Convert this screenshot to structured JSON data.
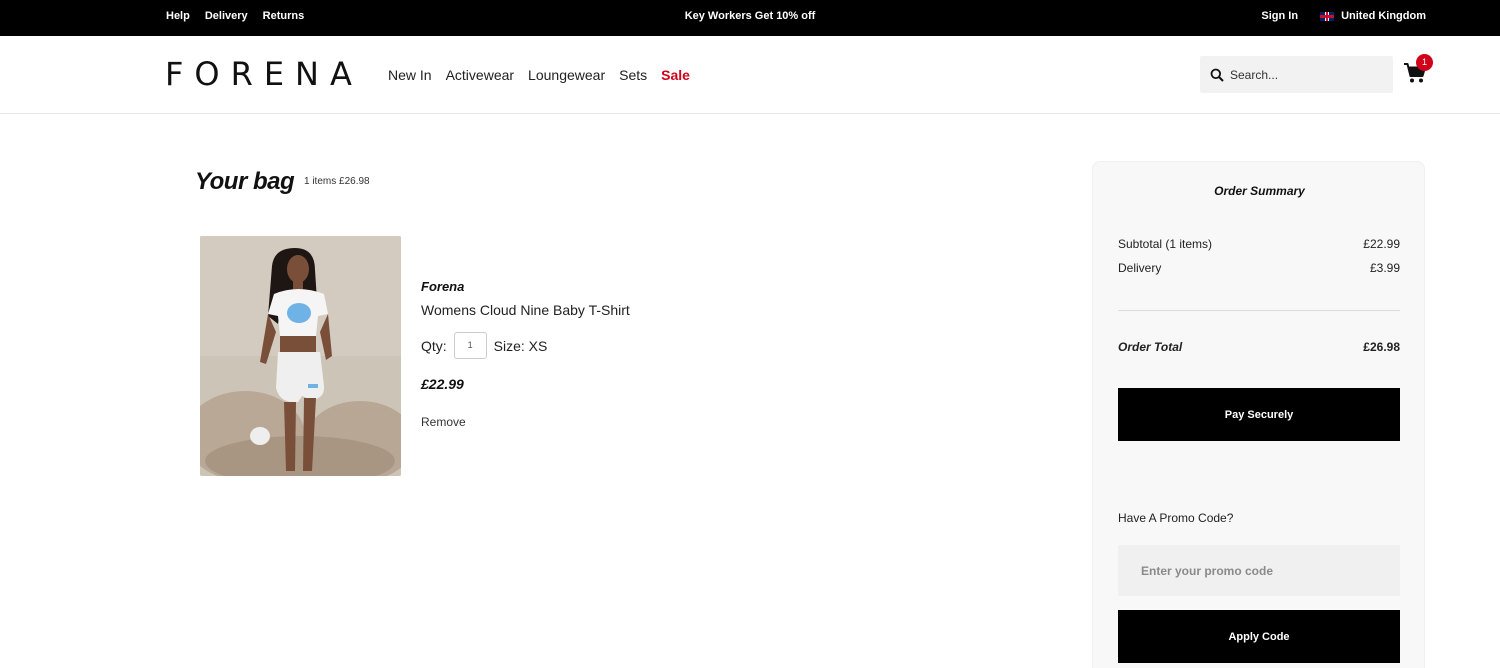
{
  "topbar": {
    "links": [
      "Help",
      "Delivery",
      "Returns"
    ],
    "promo": "Key Workers Get 10% off",
    "sign_in": "Sign In",
    "region": "United Kingdom"
  },
  "header": {
    "logo": "FORENA",
    "nav": [
      "New In",
      "Activewear",
      "Loungewear",
      "Sets",
      "Sale"
    ],
    "search_placeholder": "Search...",
    "cart_count": "1"
  },
  "bag": {
    "title": "Your bag",
    "summary": "1 items £26.98",
    "item": {
      "brand": "Forena",
      "name": "Womens Cloud Nine Baby T-Shirt",
      "qty_label": "Qty:",
      "qty_value": "1",
      "size": "Size: XS",
      "price": "£22.99",
      "remove_label": "Remove"
    }
  },
  "order_summary": {
    "title": "Order Summary",
    "subtotal_label": "Subtotal (1 items)",
    "subtotal_value": "£22.99",
    "delivery_label": "Delivery",
    "delivery_value": "£3.99",
    "total_label": "Order Total",
    "total_value": "£26.98",
    "pay_label": "Pay Securely",
    "promo_label": "Have A Promo Code?",
    "promo_placeholder": "Enter your promo code",
    "apply_label": "Apply Code"
  },
  "colors": {
    "sale": "#d0021b",
    "badge": "#d0021b",
    "topbar": "#000000"
  }
}
